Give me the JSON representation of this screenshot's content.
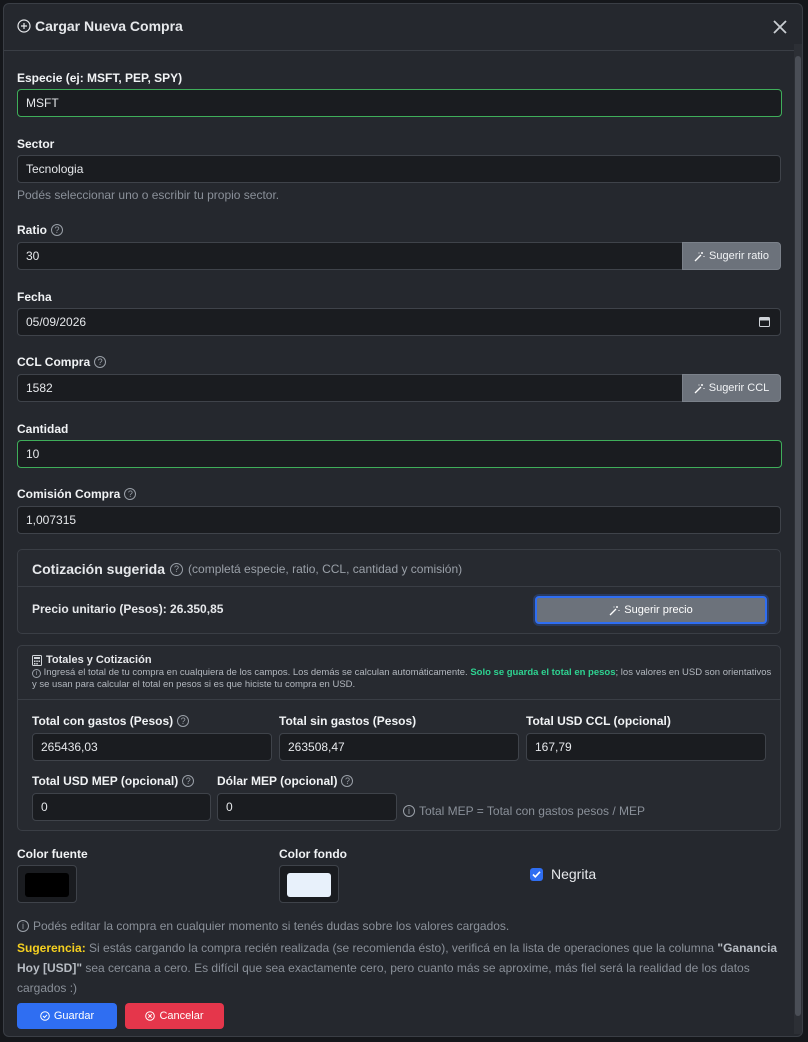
{
  "header": {
    "title": "Cargar Nueva Compra"
  },
  "especie": {
    "label": "Especie (ej: MSFT, PEP, SPY)",
    "value": "MSFT"
  },
  "sector": {
    "label": "Sector",
    "value": "Tecnologia",
    "hint": "Podés seleccionar uno o escribir tu propio sector."
  },
  "ratio": {
    "label": "Ratio",
    "value": "30",
    "button": "Sugerir ratio"
  },
  "fecha": {
    "label": "Fecha",
    "value": "05/09/2026"
  },
  "ccl": {
    "label": "CCL Compra",
    "value": "1582",
    "button": "Sugerir CCL"
  },
  "cantidad": {
    "label": "Cantidad",
    "value": "10"
  },
  "comision": {
    "label": "Comisión Compra",
    "value": "1,007315"
  },
  "cotizacion": {
    "title": "Cotización sugerida",
    "subtitle": "(completá especie, ratio, CCL, cantidad y comisión)",
    "precio_label": "Precio unitario (Pesos): 26.350,85",
    "button": "Sugerir precio"
  },
  "totales": {
    "title": "Totales y Cotización",
    "info_a": "Ingresá el total de tu compra en cualquiera de los campos. Los demás se calculan automáticamente.",
    "info_b": "Solo se guarda el total en pesos",
    "info_c": "; los valores en USD son orientativos y se usan para calcular el total en pesos si es que hiciste tu compra en USD.",
    "con_gastos": {
      "label": "Total con gastos (Pesos)",
      "value": "265436,03"
    },
    "sin_gastos": {
      "label": "Total sin gastos (Pesos)",
      "value": "263508,47"
    },
    "usd_ccl": {
      "label": "Total USD CCL (opcional)",
      "value": "167,79"
    },
    "usd_mep": {
      "label": "Total USD MEP (opcional)",
      "value": "0"
    },
    "dolar_mep": {
      "label": "Dólar MEP (opcional)",
      "value": "0"
    },
    "mep_note": "Total MEP = Total con gastos pesos / MEP"
  },
  "colors": {
    "fuente_label": "Color fuente",
    "fuente": "#000000",
    "fondo_label": "Color fondo",
    "fondo": "#e8f1fb",
    "negrita_label": "Negrita"
  },
  "footer": {
    "edit_note": "Podés editar la compra en cualquier momento si tenés dudas sobre los valores cargados.",
    "sug_label": "Sugerencia:",
    "sug_a": " Si estás cargando la compra recién realizada (se recomienda ésto), verificá en la lista de operaciones que la columna ",
    "sug_b": "\"Ganancia Hoy [USD]\"",
    "sug_c": " sea cercana a cero. Es difícil que sea exactamente cero, pero cuanto más se aproxime, más fiel será la realidad de los datos cargados :)",
    "save": "Guardar",
    "cancel": "Cancelar"
  },
  "accent": {
    "primary": "#2f6ef2",
    "danger": "#e5364b",
    "valid": "#3fae5a",
    "highlight": "#2ed391",
    "warning": "#f5d020"
  }
}
